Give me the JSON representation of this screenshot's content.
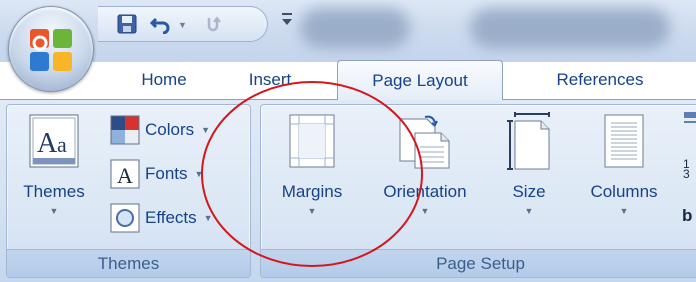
{
  "tabs": [
    {
      "label": "Home"
    },
    {
      "label": "Insert"
    },
    {
      "label": "Page Layout",
      "active": true
    },
    {
      "label": "References"
    }
  ],
  "themes_group": {
    "label": "Themes",
    "themes_button": "Themes",
    "colors_button": "Colors",
    "fonts_button": "Fonts",
    "effects_button": "Effects"
  },
  "page_setup_group": {
    "label": "Page Setup",
    "margins_button": "Margins",
    "orientation_button": "Orientation",
    "size_button": "Size",
    "columns_button": "Columns",
    "partial_text": "b"
  },
  "icons": [
    "office-orb-icon",
    "save-icon",
    "undo-icon",
    "redo-icon",
    "customize-qat-icon",
    "themes-icon",
    "colors-icon",
    "fonts-icon",
    "effects-icon",
    "margins-icon",
    "orientation-icon",
    "size-icon",
    "columns-icon"
  ],
  "colors": {
    "accent_text": "#15428b",
    "annotation_circle": "#d4161d"
  }
}
